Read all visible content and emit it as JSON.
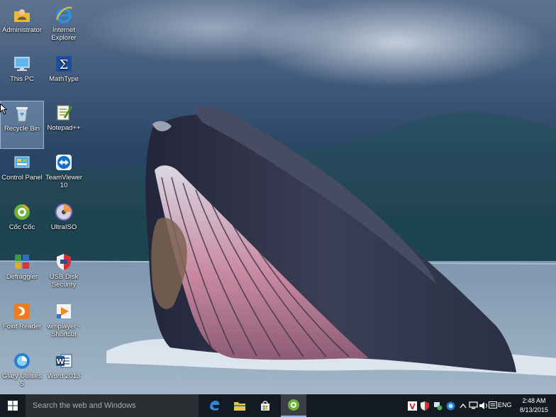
{
  "desktop_icons": [
    {
      "label": "Administrator",
      "icon": "user-folder-icon"
    },
    {
      "label": "Internet Explorer",
      "icon": "internet-explorer-icon"
    },
    {
      "label": "This PC",
      "icon": "computer-icon"
    },
    {
      "label": "MathType",
      "icon": "mathtype-icon"
    },
    {
      "label": "Recycle Bin",
      "icon": "recycle-bin-icon"
    },
    {
      "label": "Notepad++",
      "icon": "notepad-plus-plus-icon"
    },
    {
      "label": "Control Panel",
      "icon": "control-panel-icon"
    },
    {
      "label": "TeamViewer 10",
      "icon": "teamviewer-icon"
    },
    {
      "label": "Cốc Cốc",
      "icon": "coccoc-browser-icon"
    },
    {
      "label": "UltraISO",
      "icon": "ultraiso-icon"
    },
    {
      "label": "Defraggler",
      "icon": "defraggler-icon"
    },
    {
      "label": "USB Disk Security",
      "icon": "usb-disk-security-icon"
    },
    {
      "label": "Foxit Reader",
      "icon": "foxit-reader-icon"
    },
    {
      "label": "wmplayer - Shortcut",
      "icon": "wmplayer-icon"
    },
    {
      "label": "Glary Utilities 5",
      "icon": "glary-utilities-icon"
    },
    {
      "label": "Word 2013",
      "icon": "word-icon"
    }
  ],
  "taskbar": {
    "search_placeholder": "Search the web and Windows",
    "pinned_apps": [
      "edge-icon",
      "file-explorer-icon",
      "store-icon",
      "coccoc-browser-icon"
    ],
    "tray_icons": [
      "vietkey-icon",
      "shield-icon",
      "network-share-icon",
      "teamviewer-tray-icon",
      "chevron-up-icon",
      "network-icon",
      "volume-icon",
      "action-center-icon"
    ],
    "language": "ENG",
    "time": "2:48 AM",
    "date": "8/13/2015"
  },
  "colors": {
    "taskbar": "#141a21",
    "search_box": "#2b2e33",
    "active_indicator": "#8fb3e0"
  }
}
